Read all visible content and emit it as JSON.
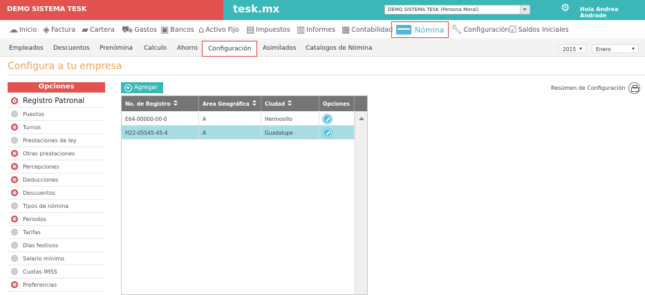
{
  "topbar": {
    "brand": "DEMO SISTEMA TESK",
    "site": "tesk.mx",
    "company_select": "DEMO SISTEMA TESK (Persona Moral)",
    "greeting": "Hola Andrea Andrade",
    "colors": {
      "brand_red": "#e2534f",
      "teal": "#3cb7b8"
    }
  },
  "main_menu": {
    "items": [
      {
        "label": "Inicio",
        "icon": "cloud-icon"
      },
      {
        "label": "Factura",
        "icon": "tag-icon"
      },
      {
        "label": "Cartera",
        "icon": "briefcase-icon"
      },
      {
        "label": "Gastos",
        "icon": "cart-icon"
      },
      {
        "label": "Bancos",
        "icon": "bank-icon"
      },
      {
        "label": "Activo Fijo",
        "icon": "house-icon"
      },
      {
        "label": "Impuestos",
        "icon": "money-icon"
      },
      {
        "label": "Informes",
        "icon": "document-icon"
      },
      {
        "label": "Contabilidad",
        "icon": "ledger-icon"
      },
      {
        "label": "Nómina",
        "icon": "card-icon",
        "active": true
      },
      {
        "label": "Configuración",
        "icon": "wrench-icon"
      },
      {
        "label": "Saldos Iniciales",
        "icon": "checklist-icon"
      }
    ]
  },
  "sub_menu": {
    "items": [
      "Empleados",
      "Descuentos",
      "Prenómina",
      "Calculo",
      "Ahorro",
      "Configuración",
      "Asimilados",
      "Catalogos de Nómina"
    ],
    "active_index": 5,
    "year": "2015",
    "month": "Enero"
  },
  "page": {
    "title": "Configura a tu empresa",
    "resumen": "Resúmen de Configuración"
  },
  "options": {
    "header": "Opciones",
    "items": [
      {
        "label": "Registro Patronal",
        "state": "selected"
      },
      {
        "label": "Puestos",
        "state": "gray"
      },
      {
        "label": "Turnos",
        "state": "red"
      },
      {
        "label": "Prestaciones de ley",
        "state": "gray"
      },
      {
        "label": "Otras prestaciones",
        "state": "red"
      },
      {
        "label": "Percepciones",
        "state": "red"
      },
      {
        "label": "Deducciones",
        "state": "red"
      },
      {
        "label": "Descuentos",
        "state": "red"
      },
      {
        "label": "Tipos de nómina",
        "state": "gray"
      },
      {
        "label": "Periodos",
        "state": "red"
      },
      {
        "label": "Tarifas",
        "state": "gray"
      },
      {
        "label": "Dias festivos",
        "state": "gray"
      },
      {
        "label": "Salario mínimo",
        "state": "gray"
      },
      {
        "label": "Cuotas IMSS",
        "state": "gray"
      },
      {
        "label": "Preferencias",
        "state": "red"
      }
    ]
  },
  "table": {
    "add_button": "Agregar",
    "columns": [
      "No. de Registro",
      "Area Geográfica",
      "Ciudad",
      "Opciones"
    ],
    "rows": [
      [
        "E64-00000-00-0",
        "A",
        "Hermosillo"
      ],
      [
        "H22-05545-45-4",
        "A",
        "Guadalupe"
      ]
    ],
    "highlight_row": 1
  }
}
